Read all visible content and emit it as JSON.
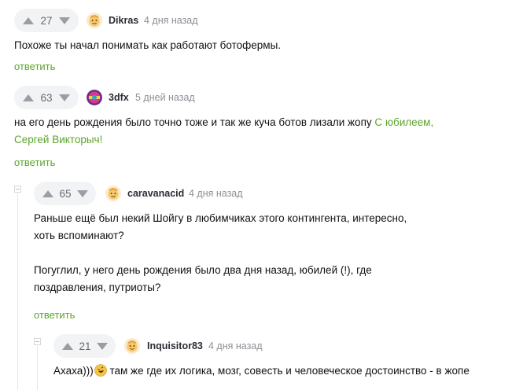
{
  "colors": {
    "accent_green": "#5ca52a",
    "rating_bg": "#f2f3f5",
    "muted": "#8b8f95"
  },
  "comments": [
    {
      "rating": "27",
      "author": "Dikras",
      "date": "4 дня назад",
      "avatar_icon": "default-avatar-icon",
      "lines": [
        "Похоже ты начал понимать как работают ботофермы."
      ],
      "reply": "ответить"
    },
    {
      "rating": "63",
      "author": "3dfx",
      "date": "5 дней назад",
      "avatar_icon": "colorful-avatar-icon",
      "line1_text": "на его день рождения было точно тоже и так же куча ботов лизали жопу ",
      "line1_link": "С юбилеем,",
      "line2_link": "Сергей Викторыч!",
      "reply": "ответить"
    },
    {
      "rating": "65",
      "author": "caravanacid",
      "date": "4 дня назад",
      "avatar_icon": "default-avatar-icon",
      "lines": [
        "Раньше ещё был некий Шойгу в любимчиках этого контингента, интересно,",
        "хоть вспоминают?",
        "Погуглил, у него день рождения было два дня назад, юбилей (!), где",
        "поздравления, путриоты?"
      ],
      "reply": "ответить"
    },
    {
      "rating": "21",
      "author": "Inquisitor83",
      "date": "4 дня назад",
      "avatar_icon": "default-avatar-icon",
      "text_before": "Ахаха)))",
      "emoji_icon": "rofl-emoji-icon",
      "text_after": " там же где их логика, мозг, совесть и человеческое достоинство - в жопе"
    }
  ]
}
